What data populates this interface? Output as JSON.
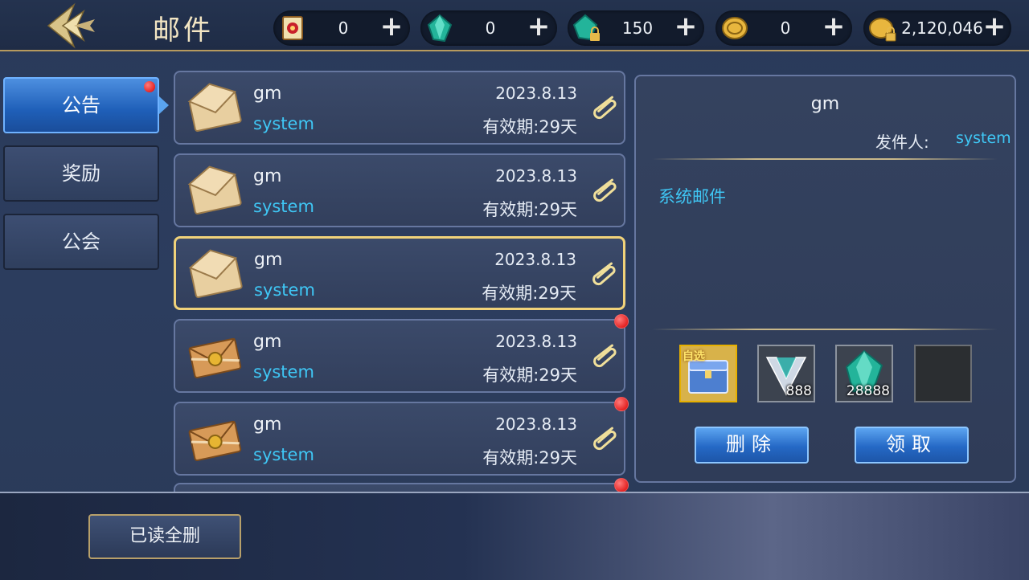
{
  "header": {
    "title": "邮件",
    "resources": [
      {
        "icon": "scroll-icon",
        "value": "0"
      },
      {
        "icon": "green-gem-icon",
        "value": "0"
      },
      {
        "icon": "locked-gem-icon",
        "value": "150"
      },
      {
        "icon": "gold-coin-icon",
        "value": "0"
      },
      {
        "icon": "locked-coin-icon",
        "value": "2,120,046"
      }
    ],
    "plus_label": "+"
  },
  "tabs": [
    {
      "label": "公告",
      "active": true,
      "badge": true
    },
    {
      "label": "奖励",
      "active": false,
      "badge": false
    },
    {
      "label": "公会",
      "active": false,
      "badge": false
    }
  ],
  "mails": [
    {
      "sender": "gm",
      "from": "system",
      "date": "2023.8.13",
      "expire": "有效期:29天",
      "envelope": "plain",
      "unread": false,
      "selected": false
    },
    {
      "sender": "gm",
      "from": "system",
      "date": "2023.8.13",
      "expire": "有效期:29天",
      "envelope": "plain",
      "unread": false,
      "selected": false
    },
    {
      "sender": "gm",
      "from": "system",
      "date": "2023.8.13",
      "expire": "有效期:29天",
      "envelope": "plain",
      "unread": false,
      "selected": true
    },
    {
      "sender": "gm",
      "from": "system",
      "date": "2023.8.13",
      "expire": "有效期:29天",
      "envelope": "sealed",
      "unread": true,
      "selected": false
    },
    {
      "sender": "gm",
      "from": "system",
      "date": "2023.8.13",
      "expire": "有效期:29天",
      "envelope": "sealed",
      "unread": true,
      "selected": false
    }
  ],
  "detail": {
    "title": "gm",
    "sender_label": "发件人:",
    "sender_value": "system",
    "body": "系统邮件",
    "items": [
      {
        "icon": "selectable-chest-icon",
        "tag": "自选",
        "count": ""
      },
      {
        "icon": "v-emblem-icon",
        "tag": "",
        "count": "888"
      },
      {
        "icon": "green-gem-icon",
        "tag": "",
        "count": "28888"
      },
      {
        "icon": "empty-slot-icon",
        "tag": "",
        "count": ""
      }
    ],
    "delete_label": "删除",
    "claim_label": "领取"
  },
  "footer": {
    "delete_read_label": "已读全删"
  },
  "colors": {
    "accent_cyan": "#3fc7f5",
    "gold_border": "#f0d27a",
    "badge_red": "#d90000",
    "button_blue": "#2569c6"
  }
}
